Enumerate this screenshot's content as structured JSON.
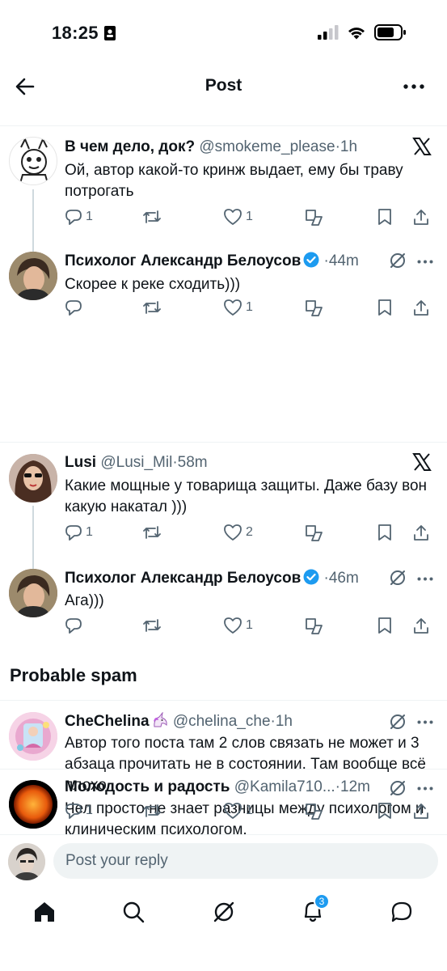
{
  "status_bar": {
    "time": "18:25"
  },
  "header": {
    "title": "Post"
  },
  "tweets": [
    {
      "name": "В чем дело, док?",
      "handle": "@smokeme_please",
      "sep": "·",
      "time": "1h",
      "text": "Ой, автор какой-то кринж выдает, ему бы траву потрогать",
      "replies": "1",
      "retweets": "",
      "likes": "1"
    },
    {
      "name": "Психолог Александр Белоусов",
      "handle": "",
      "sep": "·",
      "time": "44m",
      "text": "Скорее к реке сходить)))",
      "replies": "",
      "retweets": "",
      "likes": "1"
    },
    {
      "name": "Lusi",
      "handle": "@Lusi_Mil",
      "sep": "·",
      "time": "58m",
      "text": "Какие мощные у товарища защиты. Даже базу вон какую накатал )))",
      "replies": "1",
      "retweets": "",
      "likes": "2"
    },
    {
      "name": "Психолог Александр Белоусов",
      "handle": "",
      "sep": "·",
      "time": "46m",
      "text": "Ага)))",
      "replies": "",
      "retweets": "",
      "likes": "1"
    },
    {
      "name": "Молодость и радость",
      "handle": "@Kamila710...",
      "sep": "·",
      "time": "12m",
      "text": "Чел просто не знает разницы между психологом и клиническим психологом.",
      "replies": "",
      "retweets": "",
      "likes": ""
    },
    {
      "name": "CheChelina",
      "handle": "@chelina_che",
      "sep": "·",
      "time": "1h",
      "text": "Автор того поста там 2 слов связать не может и 3 абзаца прочитать не в состоянии. Там вообще всё плохо",
      "replies": "1",
      "retweets": "",
      "likes": "1"
    }
  ],
  "spam_section": {
    "title": "Probable spam"
  },
  "reply": {
    "placeholder": "Post your reply"
  },
  "tabs": {
    "notifications_count": "3"
  },
  "colors": {
    "accent": "#1d9bf0",
    "text": "#0f1419",
    "secondary": "#536471",
    "divider": "#eff3f4"
  },
  "icons": [
    "back-arrow-icon",
    "more-icon",
    "x-logo-icon",
    "grok-icon",
    "reply-icon",
    "retweet-icon",
    "like-icon",
    "grok-analyze-icon",
    "bookmark-icon",
    "share-icon",
    "home-icon",
    "search-icon",
    "notifications-icon",
    "messages-icon"
  ]
}
